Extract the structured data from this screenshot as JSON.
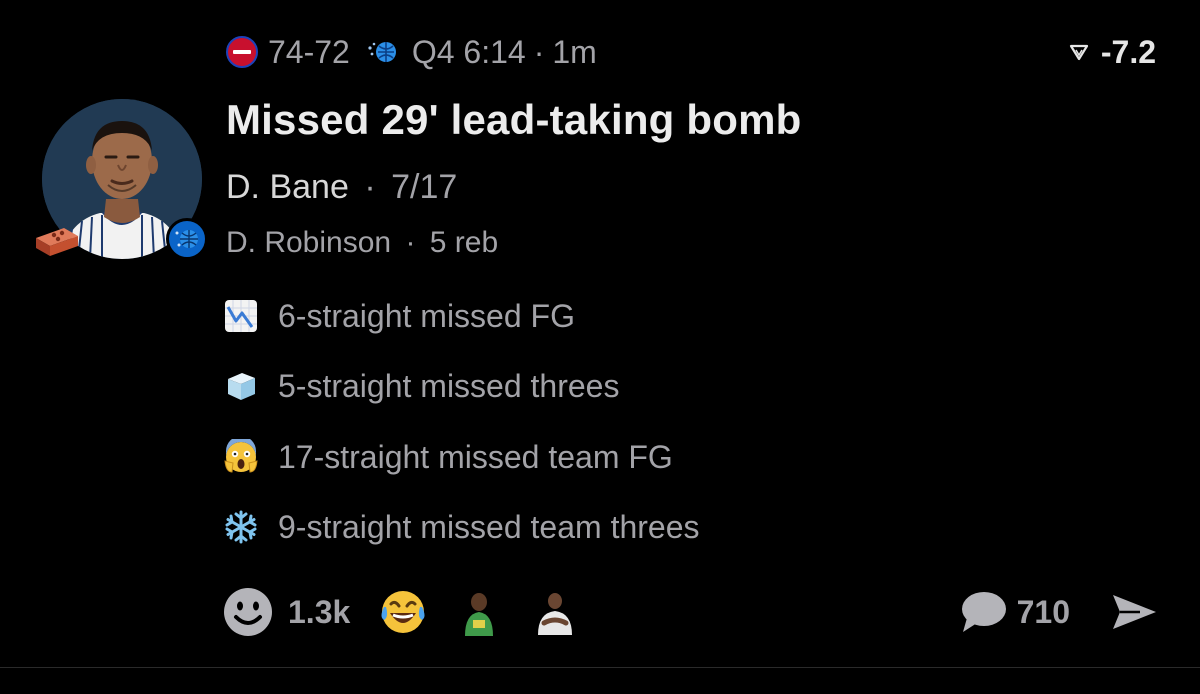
{
  "header": {
    "score": "74-72",
    "clock": "Q4 6:14",
    "separator": "·",
    "age": "1m",
    "odds_value": "-7.2",
    "team_left_icon": "pistons-logo-icon",
    "team_right_icon": "magic-logo-icon"
  },
  "play": {
    "title": "Missed 29' lead-taking bomb",
    "shooter": "D. Bane",
    "separator": "·",
    "shooter_stat": "7/17",
    "rebounder": "D. Robinson",
    "rebounder_stat": "5 reb"
  },
  "avatar": {
    "icon": "player-avatar",
    "badge_icon": "brick-icon",
    "team_badge_icon": "magic-logo-icon",
    "team_color": "#0a64c8"
  },
  "streaks": [
    {
      "icon": "chart-decreasing-icon",
      "text": "6-straight missed FG"
    },
    {
      "icon": "ice-cube-icon",
      "text": "5-straight missed threes"
    },
    {
      "icon": "screaming-face-icon",
      "text": "17-straight missed team FG"
    },
    {
      "icon": "snowflake-icon",
      "text": "9-straight missed team threes"
    }
  ],
  "footer": {
    "reaction_count": "1.3k",
    "comment_count": "710"
  },
  "colors": {
    "background": "#000000",
    "primary_text": "#ececec",
    "secondary_text": "#a3a3a8",
    "pistons_red": "#c8102e"
  }
}
